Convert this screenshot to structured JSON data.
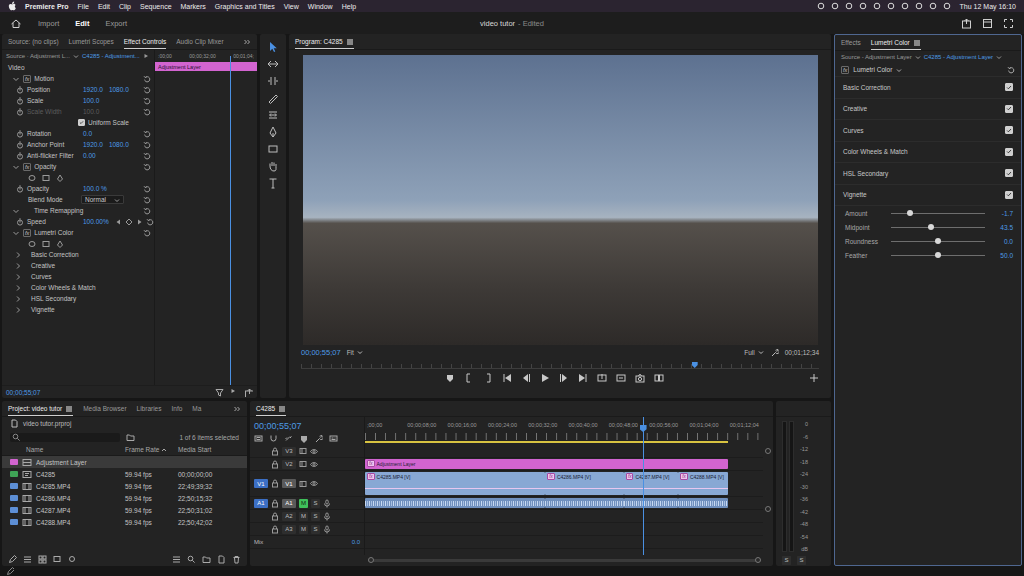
{
  "menubar": {
    "app": "Premiere Pro",
    "items": [
      "File",
      "Edit",
      "Clip",
      "Sequence",
      "Markers",
      "Graphics and Titles",
      "View",
      "Window",
      "Help"
    ],
    "clock": "Thu 12 May 16:10"
  },
  "appbar": {
    "workspaces": [
      {
        "label": "Import",
        "selected": false
      },
      {
        "label": "Edit",
        "selected": true
      },
      {
        "label": "Export",
        "selected": false
      }
    ],
    "title": "video tutor",
    "status": "- Edited"
  },
  "effect_controls": {
    "tabs": [
      {
        "label": "Source: (no clips)",
        "selected": false
      },
      {
        "label": "Lumetri Scopes",
        "selected": false
      },
      {
        "label": "Effect Controls",
        "selected": true
      },
      {
        "label": "Audio Clip Mixer",
        "selected": false
      }
    ],
    "source": "Source · Adjustment L...",
    "clip": "C4285 - Adjustment...",
    "ruler": [
      ":00;00",
      "00;00;32;00",
      "00;01;04;"
    ],
    "clip_bar": "Adjustment Layer",
    "playhead": 0.74,
    "rows": [
      {
        "kind": "section",
        "label": "Video"
      },
      {
        "kind": "effect",
        "badge": "fx",
        "label": "Motion",
        "expanded": true
      },
      {
        "kind": "param",
        "label": "Position",
        "values": [
          "1920.0",
          "1080.0"
        ],
        "disabled": false
      },
      {
        "kind": "param",
        "label": "Scale",
        "values": [
          "100.0"
        ],
        "disabled": false
      },
      {
        "kind": "param",
        "label": "Scale Width",
        "values": [
          "100.0"
        ],
        "disabled": true
      },
      {
        "kind": "checkbox",
        "label": "Uniform Scale",
        "checked": true
      },
      {
        "kind": "param",
        "label": "Rotation",
        "values": [
          "0.0"
        ],
        "disabled": false
      },
      {
        "kind": "param",
        "label": "Anchor Point",
        "values": [
          "1920.0",
          "1080.0"
        ],
        "disabled": false
      },
      {
        "kind": "param",
        "label": "Anti-flicker Filter",
        "values": [
          "0.00"
        ],
        "disabled": false
      },
      {
        "kind": "effect",
        "badge": "fx",
        "label": "Opacity",
        "expanded": true
      },
      {
        "kind": "masks"
      },
      {
        "kind": "param",
        "label": "Opacity",
        "values": [
          "100.0 %"
        ],
        "disabled": false
      },
      {
        "kind": "dropdown",
        "label": "Blend Mode",
        "value": "Normal"
      },
      {
        "kind": "effect",
        "label": "Time Remapping",
        "expanded": true
      },
      {
        "kind": "speed",
        "label": "Speed",
        "values": [
          "100.00%"
        ],
        "disabled": false
      },
      {
        "kind": "effect",
        "badge": "fx",
        "label": "Lumetri Color",
        "expanded": true
      },
      {
        "kind": "masks"
      },
      {
        "kind": "group",
        "label": "Basic Correction",
        "expanded": false
      },
      {
        "kind": "group",
        "label": "Creative",
        "expanded": false
      },
      {
        "kind": "group",
        "label": "Curves",
        "expanded": false
      },
      {
        "kind": "group",
        "label": "Color Wheels & Match",
        "expanded": false
      },
      {
        "kind": "group",
        "label": "HSL Secondary",
        "expanded": false
      },
      {
        "kind": "group",
        "label": "Vignette",
        "expanded": false
      }
    ],
    "time": "00;00;55;07"
  },
  "tools": [
    {
      "kind": "selection",
      "selected": true
    },
    {
      "kind": "track-select",
      "selected": false
    },
    {
      "kind": "ripple",
      "selected": false
    },
    {
      "kind": "razor",
      "selected": false
    },
    {
      "kind": "slip",
      "selected": false
    },
    {
      "kind": "pen",
      "selected": false
    },
    {
      "kind": "rectangle",
      "selected": false
    },
    {
      "kind": "hand",
      "selected": false
    },
    {
      "kind": "type",
      "selected": false
    }
  ],
  "program": {
    "tabs": [
      {
        "label": "Program: C4285",
        "selected": true
      }
    ],
    "timecode": "00;00;55;07",
    "zoom": "Fit",
    "quality": "Full",
    "duration": "00;01;12;34",
    "playhead": 0.76
  },
  "lumetri": {
    "tabs": [
      {
        "label": "Effects",
        "selected": false
      },
      {
        "label": "Lumetri Color",
        "selected": true
      }
    ],
    "source": "Source - Adjustment Layer",
    "clip": "C4285 - Adjustment Layer",
    "effect": {
      "badge": "fx",
      "label": "Lumetri Color"
    },
    "sections": [
      {
        "label": "Basic Correction",
        "enabled": true
      },
      {
        "label": "Creative",
        "enabled": true
      },
      {
        "label": "Curves",
        "enabled": true
      },
      {
        "label": "Color Wheels & Match",
        "enabled": true
      },
      {
        "label": "HSL Secondary",
        "enabled": true
      },
      {
        "label": "Vignette",
        "enabled": true
      }
    ],
    "vignette": [
      {
        "label": "Amount",
        "value": "-1.7",
        "level": 0.2
      },
      {
        "label": "Midpoint",
        "value": "43.5",
        "level": 0.43
      },
      {
        "label": "Roundness",
        "value": "0.0",
        "level": 0.5
      },
      {
        "label": "Feather",
        "value": "50.0",
        "level": 0.5
      }
    ]
  },
  "project": {
    "tabs": [
      {
        "label": "Project: video tutor",
        "selected": true
      },
      {
        "label": "Media Browser",
        "selected": false
      },
      {
        "label": "Libraries",
        "selected": false
      },
      {
        "label": "Info",
        "selected": false
      },
      {
        "label": "Ma",
        "selected": false
      }
    ],
    "file": "video tutor.prproj",
    "count": "1 of 6 items selected",
    "columns": [
      {
        "label": "Name",
        "sorted": false
      },
      {
        "label": "Frame Rate",
        "sorted": true
      },
      {
        "label": "Media Start",
        "sorted": false
      }
    ],
    "rows": [
      {
        "name": "Adjustment Layer",
        "kind": "adjustment",
        "color": "#d264d0",
        "selected": true
      },
      {
        "name": "C4285",
        "frame_rate": "59.94 fps",
        "media_start": "00;00;00;00",
        "kind": "sequence",
        "color": "#3fa356",
        "selected": false
      },
      {
        "name": "C4285.MP4",
        "frame_rate": "59.94 fps",
        "media_start": "22;49;39;32",
        "kind": "clip",
        "color": "#5d8fd6",
        "selected": false
      },
      {
        "name": "C4286.MP4",
        "frame_rate": "59.94 fps",
        "media_start": "22;50;15;32",
        "kind": "clip",
        "color": "#5d8fd6",
        "selected": false
      },
      {
        "name": "C4287.MP4",
        "frame_rate": "59.94 fps",
        "media_start": "22;50;31;02",
        "kind": "clip",
        "color": "#5d8fd6",
        "selected": false
      },
      {
        "name": "C4288.MP4",
        "frame_rate": "59.94 fps",
        "media_start": "22;50;42;02",
        "kind": "clip",
        "color": "#5d8fd6",
        "selected": false
      }
    ]
  },
  "timeline": {
    "tabs": [
      {
        "label": "C4285",
        "selected": true
      }
    ],
    "timecode": "00;00;55;07",
    "ruler": {
      "labels": [
        ";00;00",
        "00;00;08;00",
        "00;00;16;00",
        "00;00;24;00",
        "00;00;32;00",
        "00;00;40;00",
        "00;00;48;00",
        "00;00;56;00",
        "00;01;04;00",
        "00;01;12;04"
      ],
      "step": 8,
      "span": 79
    },
    "work_area": {
      "start": 0,
      "end": 72
    },
    "playhead": 55.1,
    "tracks": [
      {
        "name": "V3",
        "kind": "video",
        "targeted": false,
        "expanded": false,
        "clips": []
      },
      {
        "name": "V2",
        "kind": "video",
        "targeted": false,
        "expanded": false,
        "clips": [
          {
            "label": "Adjustment Layer",
            "badge": "fx",
            "start": 0,
            "end": 72,
            "color": "#d264d0"
          }
        ]
      },
      {
        "name": "V1",
        "patch": "V1",
        "kind": "video",
        "targeted": true,
        "expanded": true,
        "clips": [
          {
            "label": "C4285.MP4 [V]",
            "badge": "fx",
            "start": 0,
            "end": 35.8,
            "color": "#88a8d4"
          },
          {
            "label": "C4286.MP4 [V]",
            "badge": "fx",
            "start": 35.8,
            "end": 51.4,
            "color": "#88a8d4"
          },
          {
            "label": "C4287.MP4 [V]",
            "badge": "fx",
            "start": 51.4,
            "end": 62.2,
            "color": "#88a8d4"
          },
          {
            "label": "C4288.MP4 [V]",
            "badge": "fx",
            "start": 62.2,
            "end": 72,
            "color": "#88a8d4"
          }
        ]
      },
      {
        "name": "A1",
        "patch": "A1",
        "kind": "audio",
        "targeted": true,
        "mute": "M",
        "solo": "S",
        "muted": true,
        "clips": [
          {
            "start": 0,
            "end": 35.8,
            "color": "#6f8fbd"
          },
          {
            "start": 35.8,
            "end": 51.4,
            "color": "#6f8fbd"
          },
          {
            "start": 51.4,
            "end": 62.2,
            "color": "#6f8fbd"
          },
          {
            "start": 62.2,
            "end": 72,
            "color": "#6f8fbd"
          }
        ]
      },
      {
        "name": "A2",
        "kind": "audio",
        "targeted": false,
        "mute": "M",
        "solo": "S",
        "muted": false,
        "clips": []
      },
      {
        "name": "A3",
        "kind": "audio",
        "targeted": false,
        "mute": "M",
        "solo": "S",
        "muted": false,
        "clips": []
      },
      {
        "name": "Mix",
        "kind": "mix",
        "value": "0.0"
      }
    ]
  },
  "meter": {
    "scale": [
      "0",
      "-6",
      "-12",
      "-18",
      "-24",
      "-30",
      "-36",
      "-42",
      "-48",
      "-54",
      "dB"
    ],
    "solo": [
      "S",
      "S"
    ]
  }
}
